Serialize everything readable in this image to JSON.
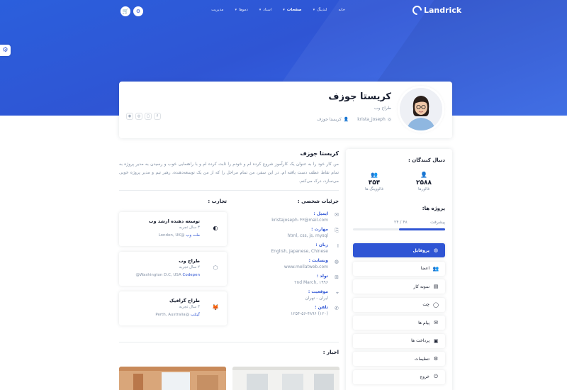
{
  "brand": "Landrick",
  "nav": {
    "items": [
      {
        "label": "خانه",
        "caret": false,
        "active": false
      },
      {
        "label": "لندینگ",
        "caret": true,
        "active": false
      },
      {
        "label": "صفحات",
        "caret": true,
        "active": true
      },
      {
        "label": "اسناد",
        "caret": true,
        "active": false
      },
      {
        "label": "دموها",
        "caret": true,
        "active": false
      },
      {
        "label": "مدیریت",
        "caret": false,
        "active": false
      }
    ]
  },
  "profile": {
    "name": "کریستا جوزف",
    "role": "طراح وب",
    "username": "krista_joseph",
    "display_name": "کریستا جوزف"
  },
  "sidebar": {
    "followers_title": "دنبال کنندگان :",
    "stats": [
      {
        "value": "۲۵۸۸",
        "label": "فالورها",
        "icon": "user-plus-icon"
      },
      {
        "value": "۴۵۴",
        "label": "فالووینگ ها",
        "icon": "users-icon"
      }
    ],
    "projects_title": "پروژه ها:",
    "progress_label": "پیشرفت",
    "progress_value": "۲۴ / ۴۸",
    "progress_fraction": 0.5,
    "menu": [
      {
        "label": "پروفایل",
        "icon": "dashboard-icon",
        "active": true
      },
      {
        "label": "اعضا",
        "icon": "users-icon",
        "active": false
      },
      {
        "label": "نمونه کار",
        "icon": "file-icon",
        "active": false
      },
      {
        "label": "چت",
        "icon": "chat-icon",
        "active": false
      },
      {
        "label": "پیام ها",
        "icon": "envelope-icon",
        "active": false
      },
      {
        "label": "پرداخت ها",
        "icon": "transactions-icon",
        "active": false
      },
      {
        "label": "تنظیمات",
        "icon": "cog-icon",
        "active": false
      },
      {
        "label": "خروج",
        "icon": "logout-icon",
        "active": false
      }
    ]
  },
  "about": {
    "title": "کریستا جوزف",
    "text": "من کار خود را به عنوان یک کارآموز شروع کرده ام و خودم را ثابت کرده ام و با راهنمایی خوب و رسیدن به مدیر پروژه به تمام نقاط عطف دست یافته ام. در این سفر، من تمام مراحل را که از من یک توسعه‌دهنده، رهبر تیم و مدیر پروژه خوبی می‌سازد، درک می‌کنم."
  },
  "details": {
    "title": "جزئیات شخصی :",
    "items": [
      {
        "label": "ایمیل :",
        "value": "kristajoseph۰۴۳@mail.com",
        "icon": "email-icon"
      },
      {
        "label": "مهارت :",
        "value": "html, css, js, mysql",
        "icon": "bookmark-icon"
      },
      {
        "label": "زبان :",
        "value": "English, Japanese, Chinese",
        "icon": "italic-icon"
      },
      {
        "label": "وبسایت :",
        "value": "www.mellatweb.com",
        "icon": "globe-icon"
      },
      {
        "label": "تولد :",
        "value": "۲nd March, ۱۹۹۶",
        "icon": "gift-icon"
      },
      {
        "label": "موقعیت :",
        "value": "ایران - تهران",
        "icon": "map-pin-icon"
      },
      {
        "label": "تلفن :",
        "value": "(۱۲۰) ۱۲۵۴-۵۶-۴۸۹۶",
        "icon": "phone-icon"
      }
    ]
  },
  "experience": {
    "title": "تجارب :",
    "items": [
      {
        "title": "توسعه دهنده ارشد وب",
        "years": "۳ سال تجربه",
        "company": "ملت وب",
        "location": "London, UK@",
        "logo": "circle-logo",
        "color": "#161c2d"
      },
      {
        "title": "طراح وب",
        "years": "۲ سال تجربه",
        "company": "Codepen",
        "location": "@Washington D.C, USA",
        "logo": "codepen-logo",
        "color": "#8492a6"
      },
      {
        "title": "طراح گرافیک",
        "years": "۳ سال تجربه",
        "company": "گیتلب",
        "location": "Perth, Australia@",
        "logo": "gitlab-logo",
        "color": "#e24329"
      }
    ]
  },
  "news": {
    "title": "اخبار :"
  },
  "colors": {
    "primary": "#2f55d4",
    "heading": "#161c2d",
    "muted": "#8492a6"
  }
}
